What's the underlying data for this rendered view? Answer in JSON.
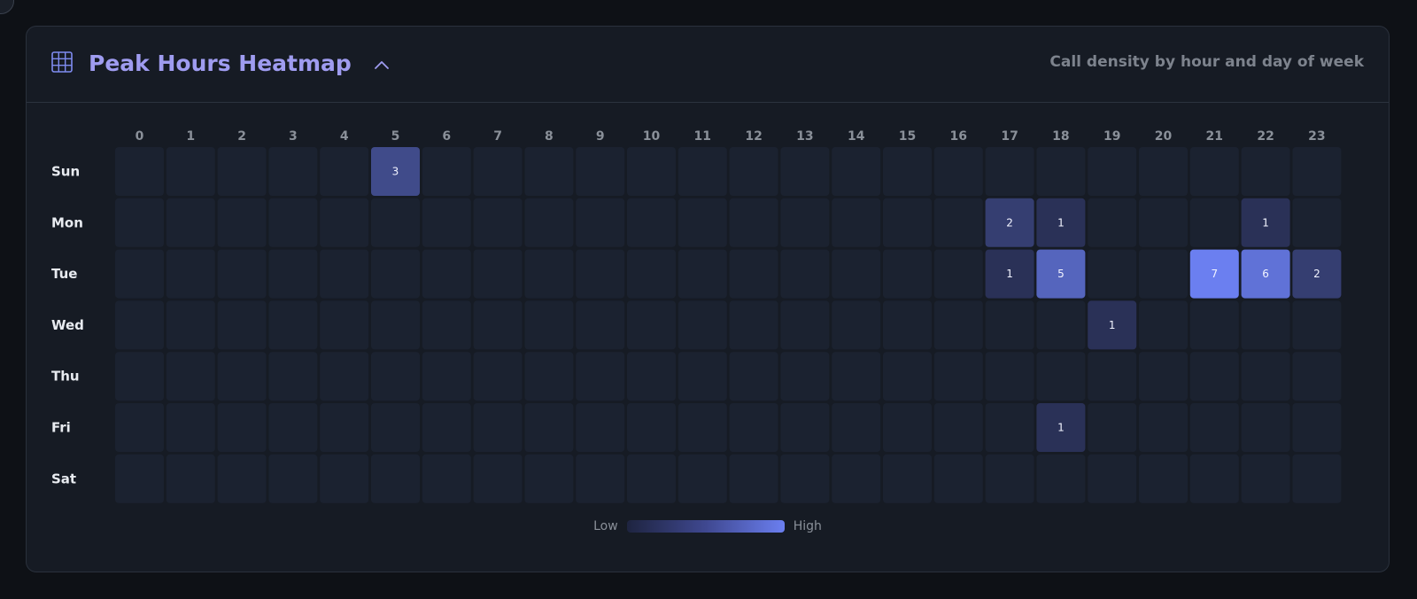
{
  "header": {
    "title": "Peak Hours Heatmap",
    "subtitle": "Call density by hour and day of week",
    "table_icon": "table-grid-icon",
    "collapse_icon": "chevron-up-icon"
  },
  "legend": {
    "low_label": "Low",
    "high_label": "High"
  },
  "colors": {
    "accent": "#9f9cf0",
    "empty_cell": "#1b2230",
    "max_cell": "#6b7ff0",
    "min_cell": "#2a3157"
  },
  "chart_data": {
    "type": "heatmap",
    "title": "Peak Hours Heatmap",
    "subtitle": "Call density by hour and day of week",
    "x": [
      "0",
      "1",
      "2",
      "3",
      "4",
      "5",
      "6",
      "7",
      "8",
      "9",
      "10",
      "11",
      "12",
      "13",
      "14",
      "15",
      "16",
      "17",
      "18",
      "19",
      "20",
      "21",
      "22",
      "23"
    ],
    "y": [
      "Sun",
      "Mon",
      "Tue",
      "Wed",
      "Thu",
      "Fri",
      "Sat"
    ],
    "values": [
      [
        0,
        0,
        0,
        0,
        0,
        3,
        0,
        0,
        0,
        0,
        0,
        0,
        0,
        0,
        0,
        0,
        0,
        0,
        0,
        0,
        0,
        0,
        0,
        0
      ],
      [
        0,
        0,
        0,
        0,
        0,
        0,
        0,
        0,
        0,
        0,
        0,
        0,
        0,
        0,
        0,
        0,
        0,
        2,
        1,
        0,
        0,
        0,
        1,
        0
      ],
      [
        0,
        0,
        0,
        0,
        0,
        0,
        0,
        0,
        0,
        0,
        0,
        0,
        0,
        0,
        0,
        0,
        0,
        1,
        5,
        0,
        0,
        7,
        6,
        2
      ],
      [
        0,
        0,
        0,
        0,
        0,
        0,
        0,
        0,
        0,
        0,
        0,
        0,
        0,
        0,
        0,
        0,
        0,
        0,
        0,
        1,
        0,
        0,
        0,
        0
      ],
      [
        0,
        0,
        0,
        0,
        0,
        0,
        0,
        0,
        0,
        0,
        0,
        0,
        0,
        0,
        0,
        0,
        0,
        0,
        0,
        0,
        0,
        0,
        0,
        0
      ],
      [
        0,
        0,
        0,
        0,
        0,
        0,
        0,
        0,
        0,
        0,
        0,
        0,
        0,
        0,
        0,
        0,
        0,
        0,
        1,
        0,
        0,
        0,
        0,
        0
      ],
      [
        0,
        0,
        0,
        0,
        0,
        0,
        0,
        0,
        0,
        0,
        0,
        0,
        0,
        0,
        0,
        0,
        0,
        0,
        0,
        0,
        0,
        0,
        0,
        0
      ]
    ],
    "color_range": [
      0,
      7
    ],
    "legend": {
      "low": "Low",
      "high": "High",
      "placement": "bottom-center"
    }
  }
}
